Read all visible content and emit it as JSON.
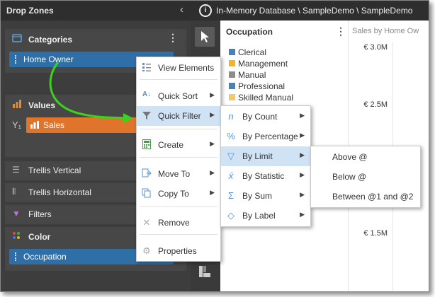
{
  "drop_zones": {
    "title": "Drop Zones",
    "collapse_glyph": "‹",
    "categories": {
      "label": "Categories",
      "pill": "Home Owner"
    },
    "values": {
      "label": "Values",
      "axis_glyph": "Y₁",
      "pill": "Sales"
    },
    "rows": [
      {
        "label": "Trellis Vertical",
        "icon": "trellis-vertical-icon"
      },
      {
        "label": "Trellis Horizontal",
        "icon": "trellis-horizontal-icon"
      },
      {
        "label": "Filters",
        "icon": "filter-icon"
      }
    ],
    "color": {
      "label": "Color",
      "pill": "Occupation"
    }
  },
  "topbar": {
    "info_glyph": "i",
    "path": "In-Memory Database \\ SampleDemo \\ SampleDemo"
  },
  "legend": {
    "title": "Occupation",
    "items": [
      {
        "label": "Clerical",
        "color": "#4a7fb8"
      },
      {
        "label": "Management",
        "color": "#f2b51c"
      },
      {
        "label": "Manual",
        "color": "#8c8c8c"
      },
      {
        "label": "Professional",
        "color": "#4a7fb8"
      },
      {
        "label": "Skilled Manual",
        "color": "#f5c96a"
      }
    ]
  },
  "chart": {
    "title": "Sales by Home Ow",
    "ticks": [
      "€ 3.0M",
      "€ 2.5M",
      "€ 1.5M"
    ]
  },
  "context_menu": {
    "items": [
      {
        "label": "View Elements",
        "icon": "view-elements-icon",
        "arrow": ""
      },
      {
        "label": "Quick Sort",
        "icon": "sort-icon",
        "arrow": "▶"
      },
      {
        "label": "Quick Filter",
        "icon": "filter-icon",
        "arrow": "▶"
      },
      {
        "label": "Create",
        "icon": "calculator-icon",
        "arrow": "▶"
      },
      {
        "label": "Move To",
        "icon": "move-icon",
        "arrow": "▶"
      },
      {
        "label": "Copy To",
        "icon": "copy-icon",
        "arrow": "▶"
      },
      {
        "label": "Remove",
        "icon": "remove-icon",
        "arrow": ""
      },
      {
        "label": "Properties",
        "icon": "gear-icon",
        "arrow": ""
      }
    ]
  },
  "filter_menu": {
    "items": [
      {
        "label": "By Count",
        "glyph": "n",
        "arrow": "▶"
      },
      {
        "label": "By Percentage",
        "glyph": "%",
        "arrow": "▶"
      },
      {
        "label": "By Limit",
        "glyph": "▽",
        "arrow": "▶"
      },
      {
        "label": "By Statistic",
        "glyph": "x̄",
        "arrow": "▶"
      },
      {
        "label": "By Sum",
        "glyph": "Σ",
        "arrow": "▶"
      },
      {
        "label": "By Label",
        "glyph": "◇",
        "arrow": "▶"
      }
    ]
  },
  "limit_menu": {
    "items": [
      "Above @",
      "Below @",
      "Between @1 and @2"
    ]
  },
  "colors": {
    "pill_blue": "#2e6fa8",
    "pill_orange": "#e0742a",
    "highlight": "#cfe3f5",
    "arrow_green": "#3bd21e"
  }
}
